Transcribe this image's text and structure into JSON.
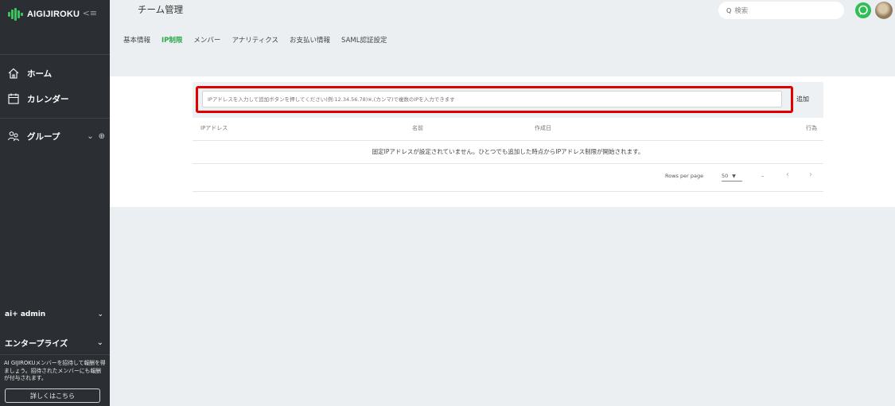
{
  "sidebar": {
    "logo_text": "AIGIJIROKU",
    "collapse_symbol": "<≡",
    "items": [
      {
        "label": "ホーム",
        "icon": "home-icon"
      },
      {
        "label": "カレンダー",
        "icon": "calendar-icon"
      },
      {
        "label": "グループ",
        "icon": "people-icon"
      }
    ],
    "group_chevron": "⌄",
    "group_add": "⊕",
    "account": {
      "label": "ai+ admin",
      "chevron": "⌄"
    },
    "plan": {
      "label": "エンタープライズ",
      "chevron": "⌄"
    },
    "promo_text": "AI GIJIROKUメンバーを招待して報酬を得ましょう。招待されたメンバーにも報酬が付与されます。",
    "promo_button": "詳しくはこちら"
  },
  "header": {
    "title": "チーム管理",
    "search_placeholder": "検索",
    "search_symbol": "Q"
  },
  "tabs": [
    {
      "label": "基本情報",
      "active": false
    },
    {
      "label": "IP制限",
      "active": true
    },
    {
      "label": "メンバー",
      "active": false
    },
    {
      "label": "アナリティクス",
      "active": false
    },
    {
      "label": "お支払い情報",
      "active": false
    },
    {
      "label": "SAML認証設定",
      "active": false
    }
  ],
  "ip_form": {
    "placeholder": "IPアドレスを入力して追加ボタンを押してください(例:12.34.56.78)※,(カンマ)で複数のIPを入力できます",
    "add_button": "追加"
  },
  "table": {
    "headers": [
      "IPアドレス",
      "名前",
      "作成日",
      "行為"
    ],
    "empty_message": "固定IPアドレスが設定されていません。ひとつでも追加した時点からIPアドレス制限が開始されます。"
  },
  "pagination": {
    "rows_per_page_label": "Rows per page",
    "rows_per_page_value": "50",
    "range": "–",
    "prev": "‹",
    "next": "›"
  },
  "colors": {
    "sidebar_bg": "#2b2f33",
    "accent": "#2fa84f",
    "highlight": "#e00000"
  }
}
